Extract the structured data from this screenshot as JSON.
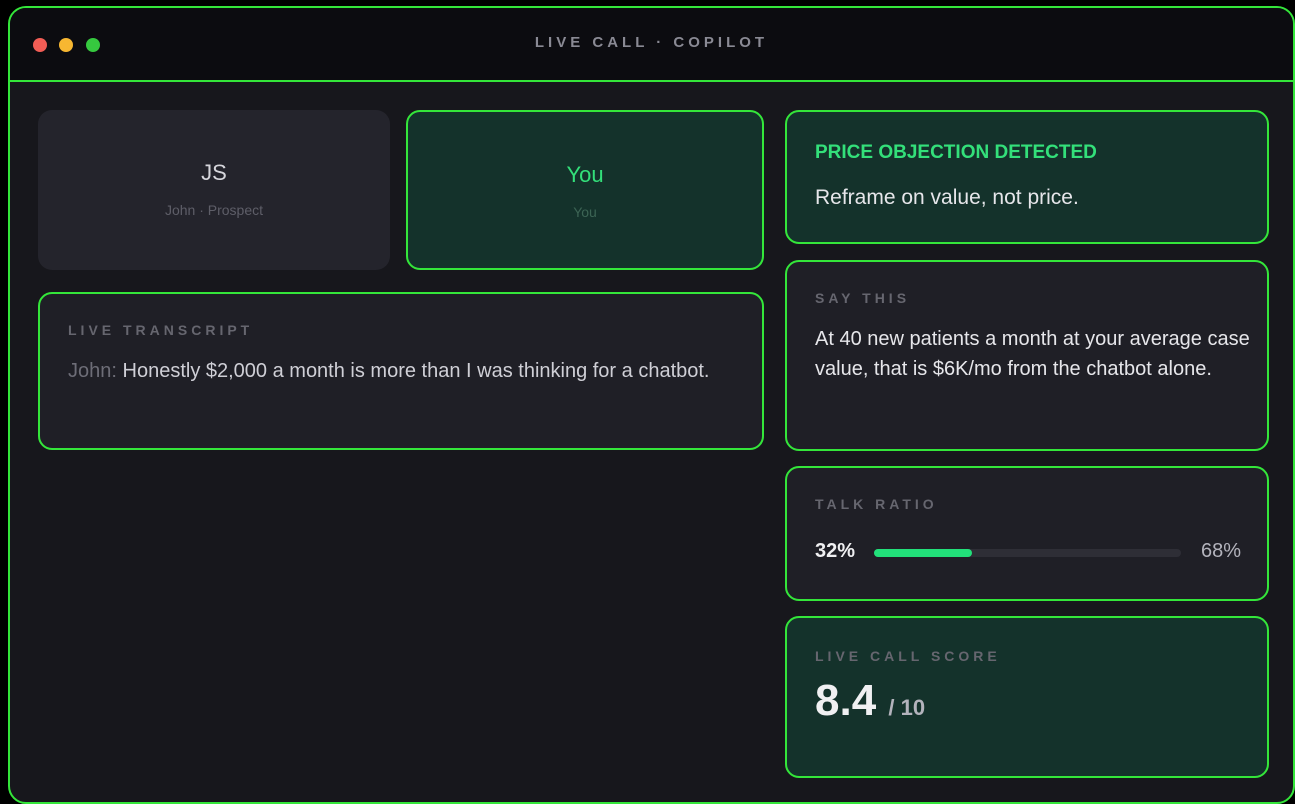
{
  "window": {
    "title": "LIVE CALL · COPILOT"
  },
  "participants": [
    {
      "initials": "JS",
      "subtitle": "John · Prospect"
    },
    {
      "initials": "You",
      "subtitle": "You"
    }
  ],
  "transcript": {
    "label": "LIVE TRANSCRIPT",
    "speaker": "John:",
    "text": "Honestly $2,000 a month is more than I was thinking for a chatbot."
  },
  "objection": {
    "title": "PRICE OBJECTION DETECTED",
    "text": "Reframe on value, not price."
  },
  "say_this": {
    "label": "SAY THIS",
    "text": "At 40 new patients a month at your average case value, that is $6K/mo from the chatbot alone."
  },
  "talk_ratio": {
    "label": "TALK RATIO",
    "you_label": "32%",
    "them_label": "68%",
    "you_value": 32
  },
  "score": {
    "label": "LIVE CALL SCORE",
    "value": "8.4",
    "max": "/ 10"
  },
  "colors": {
    "accent": "#34e63a",
    "highlight": "#33e07a",
    "bar_fill": "#22e07a"
  }
}
